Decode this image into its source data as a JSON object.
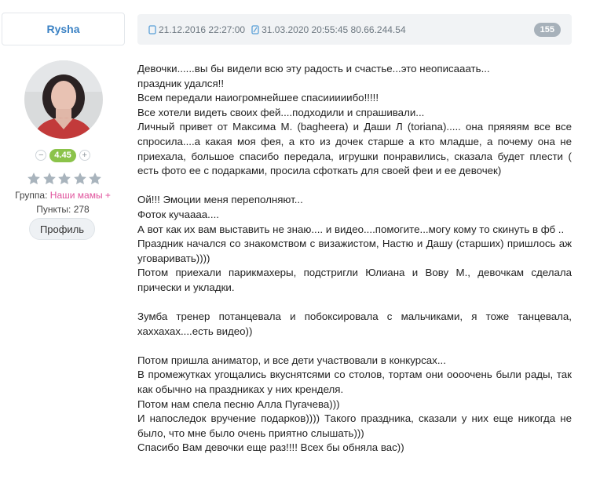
{
  "user": {
    "name": "Rysha",
    "reputation_minus": "−",
    "reputation": "4.45",
    "reputation_plus": "+",
    "stars": 5,
    "group_label": "Группа:",
    "group_value": "Наши мамы +",
    "points_label": "Пункты:",
    "points_value": "278",
    "profile_button": "Профиль"
  },
  "post": {
    "created": "21.12.2016 22:27:00",
    "edited": "31.03.2020 20:55:45 80.66.244.54",
    "number": "155",
    "lines": [
      "Девочки......вы бы видели всю эту радость и счастье...это неописааать...",
      "праздник удался!!",
      "Всем передали наиогромнейшее спасииииибо!!!!!",
      "Все хотели видеть своих фей....подходили и спрашивали...",
      "Личный привет от Максима М. (bagheera) и Даши Л (toriana)..... она пряяяям все все спросила....а какая моя фея, а кто из дочек старше а кто младше, а почему она не приехала, большое спасибо передала, игрушки понравились, сказала будет плести ( есть фото ее с подарками, просила сфоткать для своей феи и ее девочек)",
      "",
      "Ой!!! Эмоции меня переполняют...",
      "Фоток кучаааа....",
      "А вот как их вам выставить не знаю.... и видео....помогите...могу кому то скинуть в фб ..",
      "Праздник начался со знакомством с визажистом, Настю и Дашу (старших) пришлось аж уговаривать))))",
      "Потом приехали парикмахеры, подстригли Юлиана и Вову М., девочкам сделала прически и укладки.",
      "",
      "Зумба тренер потанцевала и побоксировала с мальчиками, я тоже танцевала, хаххахах....есть видео))",
      "",
      "Потом пришла аниматор, и все дети участвовали в конкурсах...",
      "В промежутках угощались вкуснятсями со столов, тортам они оооочень были рады, так как обычно на праздниках у них кренделя.",
      "Потом нам спела песню Алла Пугачева)))",
      "И напоследок вручение подарков)))) Такого праздника, сказали у них еще никогда не было, что мне было очень приятно слышать)))",
      "Спасибо Вам девочки еще раз!!!! Всех бы обняла вас))"
    ]
  },
  "colors": {
    "username": "#3b82c4",
    "reputation_bg": "#8bc34a",
    "group_link": "#e0529c",
    "star": "#a9b4bd",
    "header_bg": "#f1f3f5",
    "count_badge": "#a7b1ba"
  }
}
